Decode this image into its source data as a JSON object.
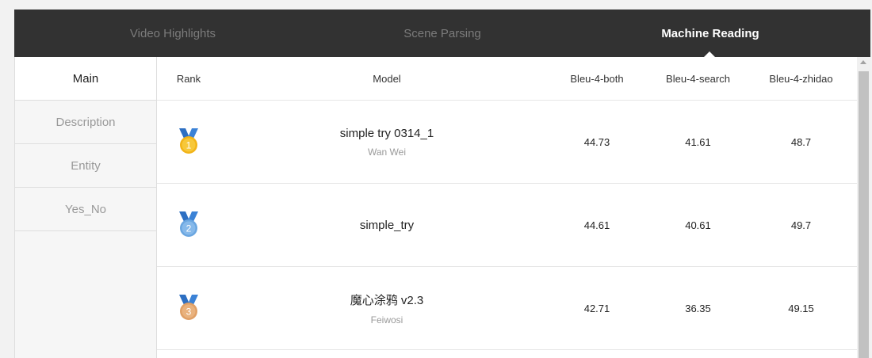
{
  "topnav": {
    "tabs": [
      {
        "label": "Video Highlights",
        "active": false
      },
      {
        "label": "Scene Parsing",
        "active": false
      },
      {
        "label": "Machine Reading",
        "active": true
      }
    ]
  },
  "sidebar": {
    "items": [
      {
        "label": "Main",
        "active": true
      },
      {
        "label": "Description",
        "active": false
      },
      {
        "label": "Entity",
        "active": false
      },
      {
        "label": "Yes_No",
        "active": false
      }
    ]
  },
  "table": {
    "columns": [
      "Rank",
      "Model",
      "Bleu-4-both",
      "Bleu-4-search",
      "Bleu-4-zhidao"
    ],
    "rows": [
      {
        "rank": "1",
        "medal": "gold",
        "model": "simple try 0314_1",
        "author": "Wan Wei",
        "bleu_both": "44.73",
        "bleu_search": "41.61",
        "bleu_zhidao": "48.7"
      },
      {
        "rank": "2",
        "medal": "silver",
        "model": "simple_try",
        "author": "",
        "bleu_both": "44.61",
        "bleu_search": "40.61",
        "bleu_zhidao": "49.7"
      },
      {
        "rank": "3",
        "medal": "bronze",
        "model": "魔心涂鸦 v2.3",
        "author": "Feiwosi",
        "bleu_both": "42.71",
        "bleu_search": "36.35",
        "bleu_zhidao": "49.15"
      }
    ]
  },
  "colors": {
    "nav_bg": "#323232",
    "gold": "#f2b418",
    "silver": "#6aa6e0",
    "bronze": "#e0a066",
    "ribbon": "#2d6fc2"
  },
  "icons": {
    "medal": "medal-icon",
    "scroll_up": "scroll-up-arrow-icon"
  }
}
